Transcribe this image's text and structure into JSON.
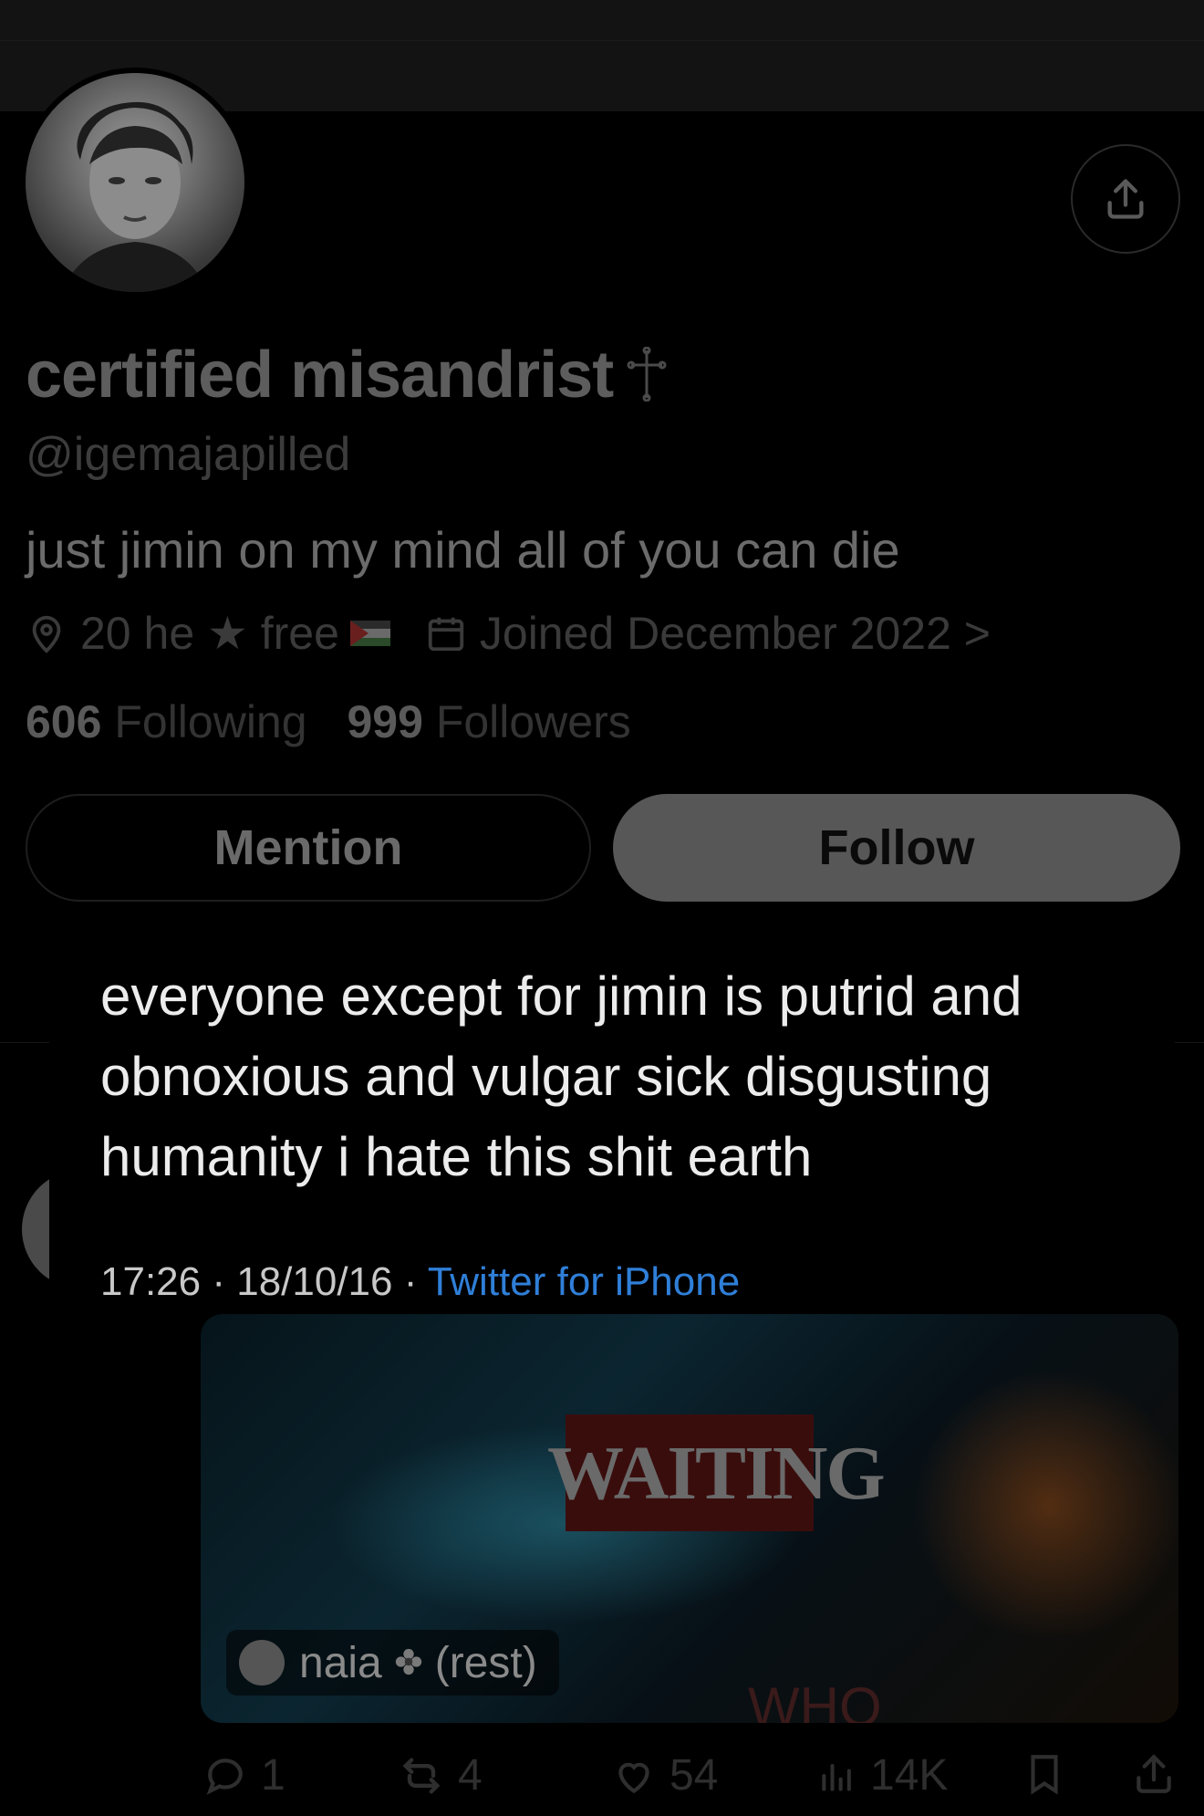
{
  "profile": {
    "display_name": "certified misandrist",
    "handle": "@igemajapilled",
    "bio": "just jimin on my mind all of you can die",
    "location": "20 he ★ free",
    "joined": "Joined December 2022 >",
    "following_count": "606",
    "following_label": "Following",
    "followers_count": "999",
    "followers_label": "Followers"
  },
  "buttons": {
    "mention": "Mention",
    "follow": "Follow"
  },
  "quote": {
    "text": "everyone except for jimin is putrid and obnoxious and vulgar sick disgusting humanity i hate this shit earth",
    "time": "17:26",
    "date": "18/10/16",
    "separator": " · ",
    "source": "Twitter for iPhone"
  },
  "media": {
    "sign_text": "WAITING",
    "bottom_text": "WHO",
    "label_name": "naia",
    "label_rest": "(rest)"
  },
  "actions": {
    "replies": "1",
    "reposts": "4",
    "likes": "54",
    "views": "14K"
  },
  "colors": {
    "background": "#000000",
    "link_blue": "#2f7fd8",
    "follow_bg": "#575757"
  }
}
